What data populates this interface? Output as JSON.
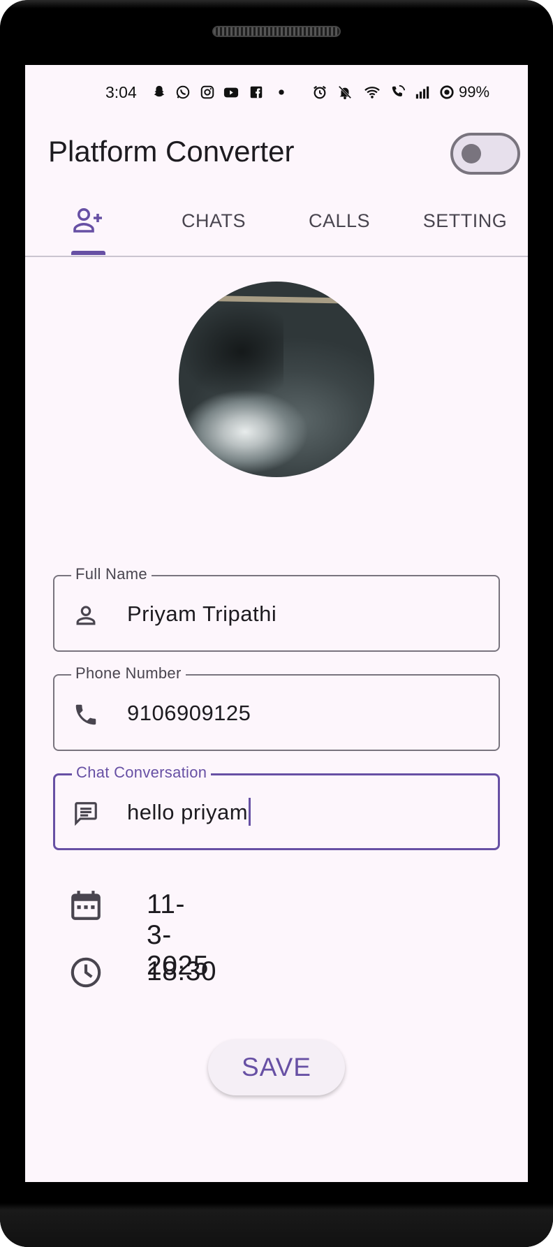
{
  "status_bar": {
    "time": "3:04",
    "battery": "99%",
    "icons": [
      "snapchat-icon",
      "whatsapp-icon",
      "instagram-icon",
      "youtube-icon",
      "facebook-icon",
      "dot-icon",
      "alarm-icon",
      "mute-icon",
      "wifi-icon",
      "wifi-call-icon",
      "signal-icon",
      "data-saver-icon"
    ]
  },
  "app_bar": {
    "title": "Platform Converter",
    "theme_toggle_on": false
  },
  "tabs": [
    {
      "label": "",
      "icon": "person-add-icon",
      "selected": true
    },
    {
      "label": "CHATS",
      "selected": false
    },
    {
      "label": "CALLS",
      "selected": false
    },
    {
      "label": "SETTING",
      "selected": false
    }
  ],
  "form": {
    "full_name": {
      "label": "Full Name",
      "value": "Priyam Tripathi",
      "icon": "person-icon"
    },
    "phone": {
      "label": "Phone Number",
      "value": "9106909125",
      "icon": "phone-icon"
    },
    "chat": {
      "label": "Chat Conversation",
      "value": "hello priyam",
      "icon": "message-icon"
    }
  },
  "date": {
    "value": "11-3-2025",
    "icon": "calendar-icon"
  },
  "time": {
    "value": "18:30",
    "icon": "clock-icon"
  },
  "save_button": {
    "label": "SAVE"
  },
  "colors": {
    "accent": "#6750a4",
    "background": "#fdf6fc",
    "outline": "#79747e",
    "text": "#1d1b20"
  }
}
